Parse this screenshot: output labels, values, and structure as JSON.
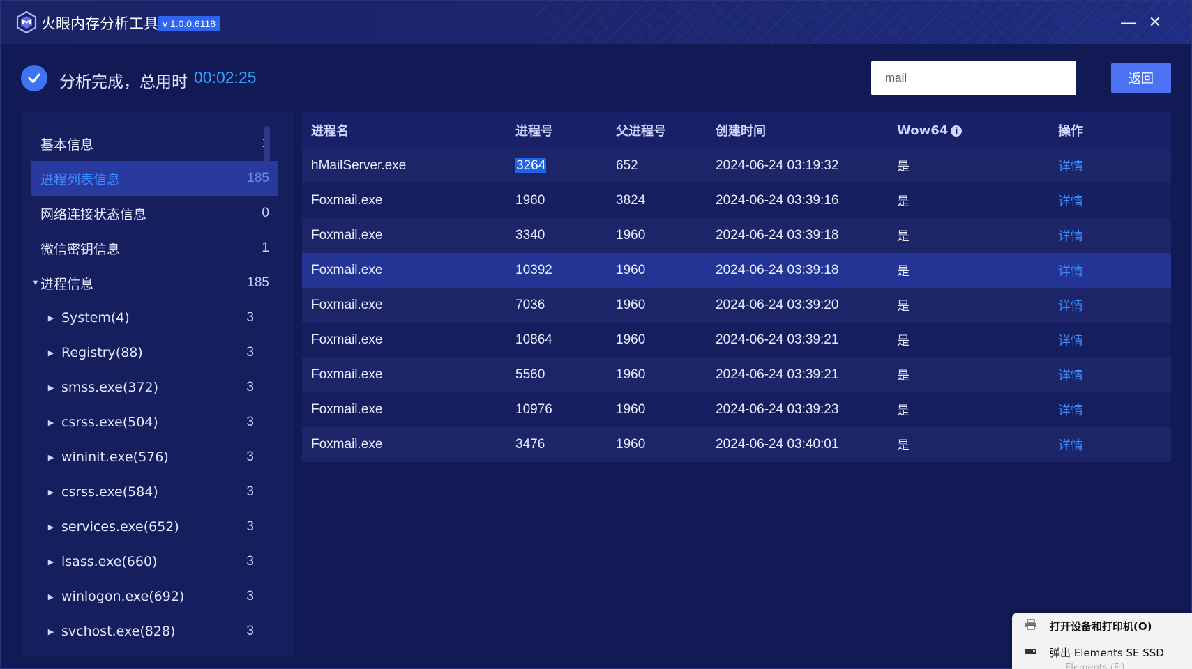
{
  "app": {
    "title": "火眼内存分析工具",
    "version": "v 1.0.0.6118",
    "minimize": "—",
    "close": "✕"
  },
  "status": {
    "text": "分析完成，总用时",
    "time": "00:02:25"
  },
  "search": {
    "value": "mail"
  },
  "back_button": "返回",
  "sidebar": {
    "items": [
      {
        "label": "基本信息",
        "count": "1",
        "caret": ""
      },
      {
        "label": "进程列表信息",
        "count": "185",
        "caret": "",
        "active": true
      },
      {
        "label": "网络连接状态信息",
        "count": "0",
        "caret": ""
      },
      {
        "label": "微信密钥信息",
        "count": "1",
        "caret": ""
      },
      {
        "label": "进程信息",
        "count": "185",
        "caret": "▼"
      },
      {
        "label": "System(4)",
        "count": "3",
        "caret": "▶"
      },
      {
        "label": "Registry(88)",
        "count": "3",
        "caret": "▶"
      },
      {
        "label": "smss.exe(372)",
        "count": "3",
        "caret": "▶"
      },
      {
        "label": "csrss.exe(504)",
        "count": "3",
        "caret": "▶"
      },
      {
        "label": "wininit.exe(576)",
        "count": "3",
        "caret": "▶"
      },
      {
        "label": "csrss.exe(584)",
        "count": "3",
        "caret": "▶"
      },
      {
        "label": "services.exe(652)",
        "count": "3",
        "caret": "▶"
      },
      {
        "label": "lsass.exe(660)",
        "count": "3",
        "caret": "▶"
      },
      {
        "label": "winlogon.exe(692)",
        "count": "3",
        "caret": "▶"
      },
      {
        "label": "svchost.exe(828)",
        "count": "3",
        "caret": "▶"
      }
    ]
  },
  "table": {
    "headers": [
      "进程名",
      "进程号",
      "父进程号",
      "创建时间",
      "Wow64",
      "操作"
    ],
    "info_icon": "i",
    "rows": [
      {
        "name": "hMailServer.exe",
        "pid": "3264",
        "ppid": "652",
        "time": "2024-06-24 03:19:32",
        "wow64": "是",
        "action": "详情"
      },
      {
        "name": "Foxmail.exe",
        "pid": "1960",
        "ppid": "3824",
        "time": "2024-06-24 03:39:16",
        "wow64": "是",
        "action": "详情"
      },
      {
        "name": "Foxmail.exe",
        "pid": "3340",
        "ppid": "1960",
        "time": "2024-06-24 03:39:18",
        "wow64": "是",
        "action": "详情"
      },
      {
        "name": "Foxmail.exe",
        "pid": "10392",
        "ppid": "1960",
        "time": "2024-06-24 03:39:18",
        "wow64": "是",
        "action": "详情"
      },
      {
        "name": "Foxmail.exe",
        "pid": "7036",
        "ppid": "1960",
        "time": "2024-06-24 03:39:20",
        "wow64": "是",
        "action": "详情"
      },
      {
        "name": "Foxmail.exe",
        "pid": "10864",
        "ppid": "1960",
        "time": "2024-06-24 03:39:21",
        "wow64": "是",
        "action": "详情"
      },
      {
        "name": "Foxmail.exe",
        "pid": "5560",
        "ppid": "1960",
        "time": "2024-06-24 03:39:21",
        "wow64": "是",
        "action": "详情"
      },
      {
        "name": "Foxmail.exe",
        "pid": "10976",
        "ppid": "1960",
        "time": "2024-06-24 03:39:23",
        "wow64": "是",
        "action": "详情"
      },
      {
        "name": "Foxmail.exe",
        "pid": "3476",
        "ppid": "1960",
        "time": "2024-06-24 03:40:01",
        "wow64": "是",
        "action": "详情"
      }
    ]
  },
  "context_menu": {
    "items": [
      {
        "label": "打开设备和打印机(O)",
        "icon": "printer-icon"
      },
      {
        "label": "弹出 Elements SE SSD",
        "icon": "drive-icon"
      }
    ],
    "partial": "Elements (F:)"
  },
  "colors": {
    "background": "#121a56",
    "accent": "#4a72f3",
    "link": "#3a8cff",
    "time": "#3aa0ff"
  }
}
